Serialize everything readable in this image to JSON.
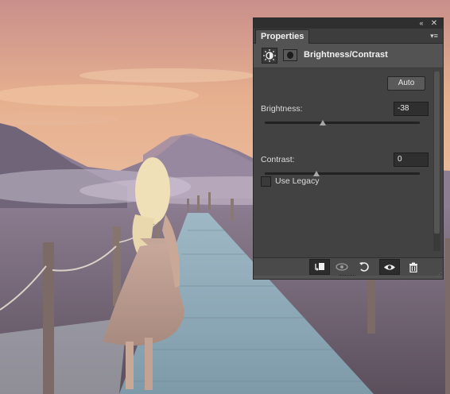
{
  "panel": {
    "tab_label": "Properties",
    "collapse_glyph": "«",
    "close_glyph": "✕",
    "menu_glyph": "▾≡",
    "adjustment_title": "Brightness/Contrast",
    "adjustment_icon": "brightness-contrast-icon",
    "mask_icon": "layer-mask-icon",
    "auto_label": "Auto",
    "brightness_label": "Brightness:",
    "brightness_value": "-38",
    "contrast_label": "Contrast:",
    "contrast_value": "0",
    "legacy_label": "Use Legacy",
    "legacy_checked": false,
    "slider_range": [
      -150,
      150
    ],
    "contrast_range": [
      -50,
      100
    ],
    "bottom_icons": [
      "clip-to-layer-icon",
      "view-previous-state-icon",
      "reset-icon",
      "toggle-visibility-icon",
      "delete-icon"
    ]
  },
  "colors": {
    "panel_bg": "#535353",
    "body_bg": "#424242",
    "field_bg": "#2f2f2f",
    "text": "#e6e6e6"
  }
}
